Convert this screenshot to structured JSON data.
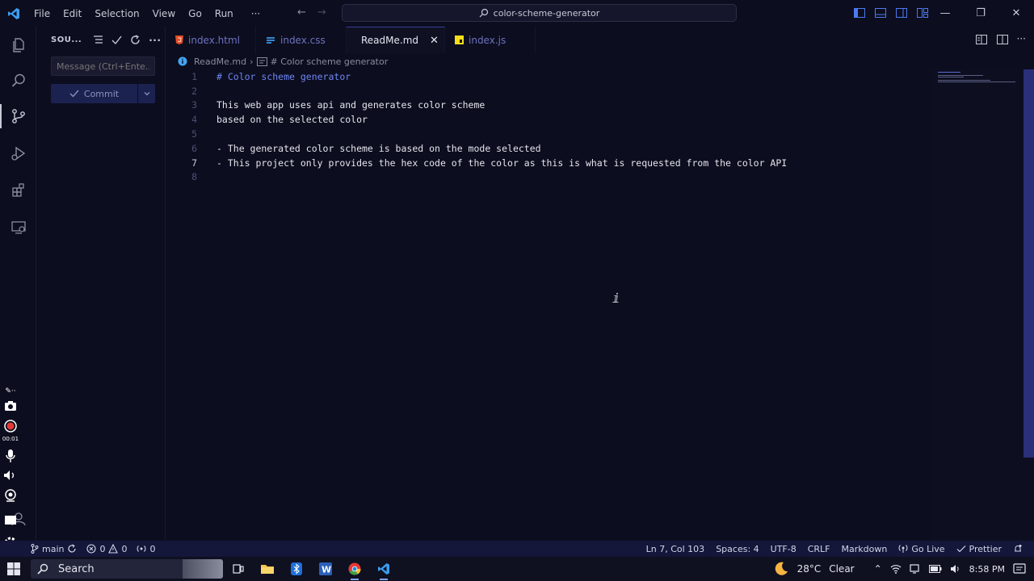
{
  "titlebar": {
    "menu": [
      "File",
      "Edit",
      "Selection",
      "View",
      "Go",
      "Run",
      "···"
    ],
    "command_center": "color-scheme-generator",
    "window_controls": [
      "minimize-icon",
      "restore-icon",
      "close-icon"
    ]
  },
  "activity_bar": [
    "explorer-icon",
    "search-icon",
    "source-control-icon",
    "run-debug-icon",
    "extensions-icon",
    "remote-explorer-icon",
    "account-icon",
    "settings-icon"
  ],
  "sidebar": {
    "title": "SOU...",
    "message_placeholder": "Message (Ctrl+Ente...",
    "commit_label": "Commit"
  },
  "tabs": [
    {
      "label": "index.html",
      "icon": "html-icon",
      "color": "#e44d26"
    },
    {
      "label": "index.css",
      "icon": "css-icon",
      "color": "#42a5f5"
    },
    {
      "label": "ReadMe.md",
      "icon": "info-icon",
      "color": "#42a5f5",
      "active": true
    },
    {
      "label": "index.js",
      "icon": "js-icon",
      "color": "#f5de19"
    }
  ],
  "breadcrumb": {
    "file": "ReadMe.md",
    "symbol": "# Color scheme generator"
  },
  "editor": {
    "lines": [
      {
        "n": "1",
        "text": "# Color scheme generator"
      },
      {
        "n": "2",
        "text": ""
      },
      {
        "n": "3",
        "text": "This web app uses api and generates color scheme"
      },
      {
        "n": "4",
        "text": "based on the selected color"
      },
      {
        "n": "5",
        "text": ""
      },
      {
        "n": "6",
        "text": "- The generated color scheme is based on the mode selected"
      },
      {
        "n": "7",
        "text": "- This project only provides the hex code of the color as this is what is requested from the color API"
      },
      {
        "n": "8",
        "text": ""
      }
    ],
    "current_line": 7
  },
  "recorder": {
    "timer": "00:01"
  },
  "statusbar": {
    "branch": "main",
    "errors": "0",
    "warnings": "0",
    "ports": "0",
    "position": "Ln 7, Col 103",
    "spaces": "Spaces: 4",
    "encoding": "UTF-8",
    "eol": "CRLF",
    "language": "Markdown",
    "go_live": "Go Live",
    "prettier": "Prettier"
  },
  "taskbar": {
    "search": "Search",
    "weather": "28°C",
    "weather_text": "Clear",
    "time": "8:58 PM"
  }
}
